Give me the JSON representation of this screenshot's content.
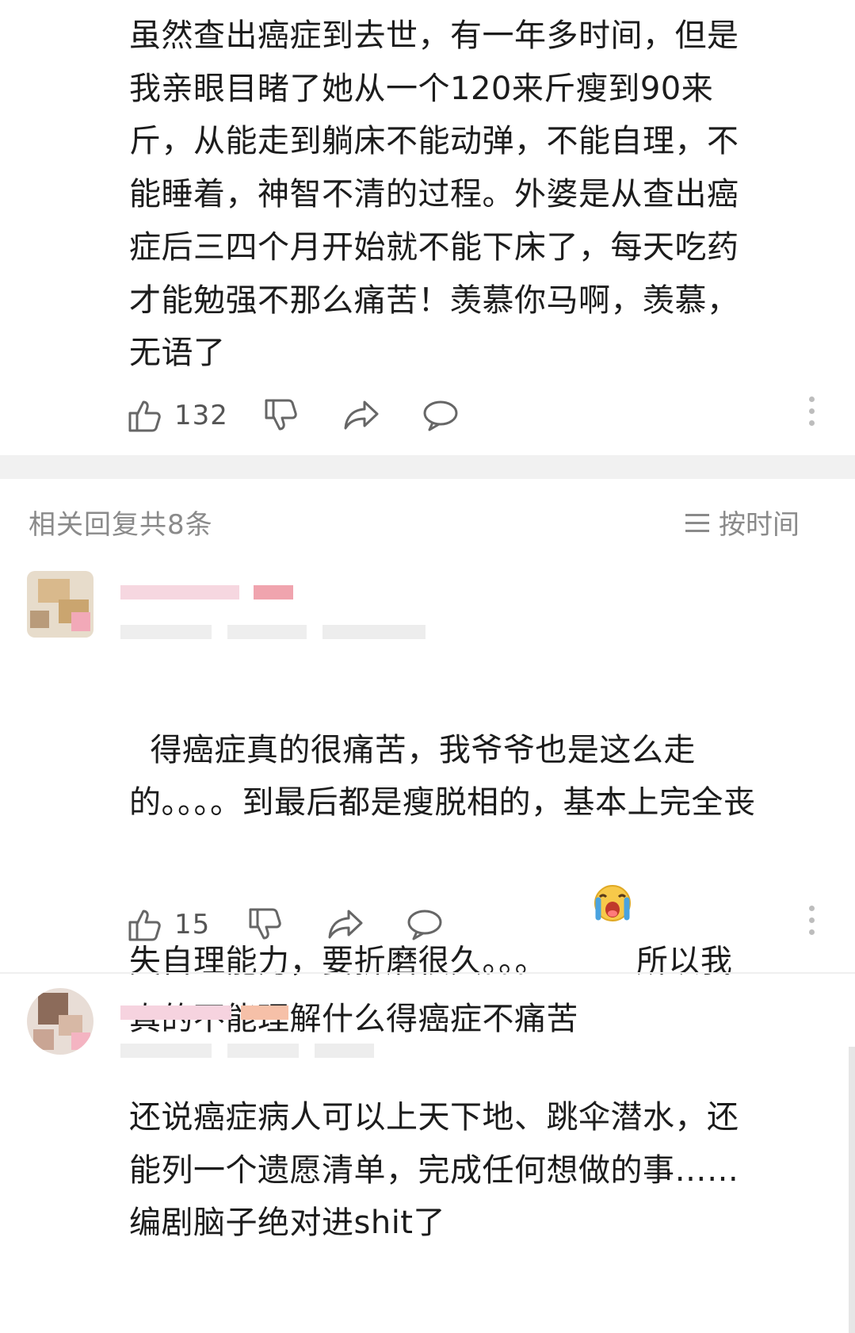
{
  "comment_top": {
    "text": "虽然查出癌症到去世，有一年多时间，但是我亲眼目睹了她从一个120来斤瘦到90来斤，从能走到躺床不能动弹，不能自理，不能睡着，神智不清的过程。外婆是从查出癌症后三四个月开始就不能下床了，每天吃药才能勉强不那么痛苦！羡慕你马啊，羡慕，无语了",
    "like_count": "132"
  },
  "replies_header": {
    "title": "相关回复共8条",
    "sort_label": "按时间"
  },
  "replies": [
    {
      "text_before_emoji": "得癌症真的很痛苦，我爷爷也是这么走的。。。。到最后都是瘦脱相的，基本上完全丧失自理能力，要折磨很久。。。",
      "emoji": "crying-face-emoji",
      "text_after_emoji": "所以我真的不能理解什么得癌症不痛苦",
      "like_count": "15"
    },
    {
      "text": "还说癌症病人可以上天下地、跳伞潜水，还能列一个遗愿清单，完成任何想做的事……编剧脑子绝对进shit了"
    }
  ],
  "icons": {
    "like": "thumbs-up-icon",
    "dislike": "thumbs-down-icon",
    "share": "share-icon",
    "comment": "comment-icon",
    "more": "more-vertical-icon",
    "sort": "sort-lines-icon"
  },
  "colors": {
    "text": "#1c1c1c",
    "muted": "#8a8a8a",
    "separator": "#f1f1f1"
  }
}
